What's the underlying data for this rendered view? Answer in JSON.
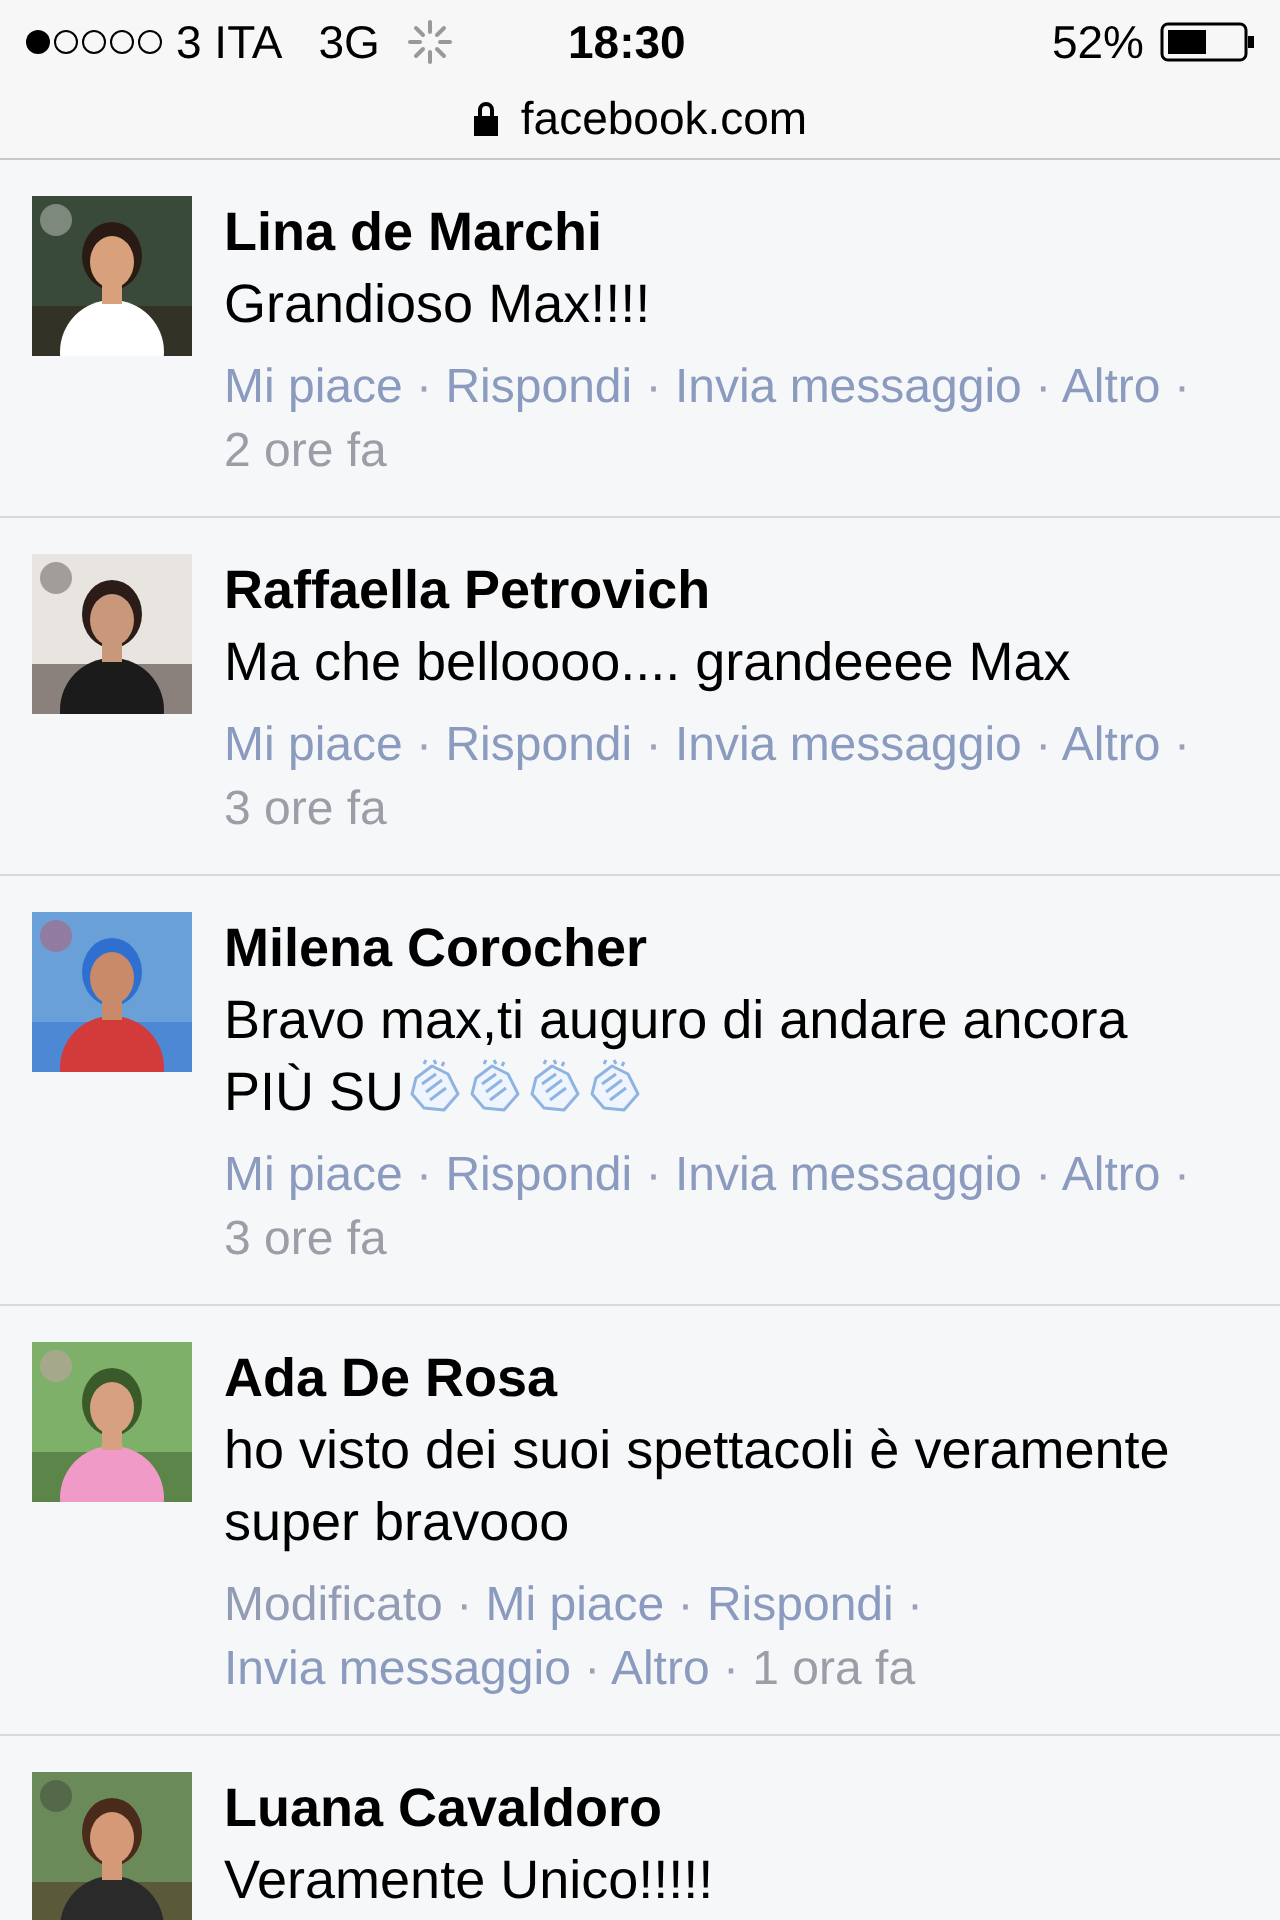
{
  "status_bar": {
    "carrier": "3 ITA",
    "network": "3G",
    "time": "18:30",
    "battery": "52%"
  },
  "address_bar": {
    "url": "facebook.com"
  },
  "separator": "·",
  "comments": [
    {
      "author": "Lina de Marchi",
      "text": "Grandioso Max!!!!",
      "actions": [
        {
          "kind": "link",
          "label": "Mi piace"
        },
        {
          "kind": "link",
          "label": "Rispondi"
        },
        {
          "kind": "link",
          "label": "Invia messaggio"
        },
        {
          "kind": "link",
          "label": "Altro"
        }
      ],
      "time": "2 ore fa"
    },
    {
      "author": "Raffaella Petrovich",
      "text": "Ma che belloooo.... grandeeee Max",
      "actions": [
        {
          "kind": "link",
          "label": "Mi piace"
        },
        {
          "kind": "link",
          "label": "Rispondi"
        },
        {
          "kind": "link",
          "label": "Invia messaggio"
        },
        {
          "kind": "link",
          "label": "Altro"
        }
      ],
      "time": "3 ore fa"
    },
    {
      "author": "Milena Corocher",
      "text": "Bravo max,ti auguro di andare ancora PIÙ SU",
      "trailing_icons": [
        {
          "kind": "clap"
        },
        {
          "kind": "clap"
        },
        {
          "kind": "clap"
        },
        {
          "kind": "clap"
        }
      ],
      "actions": [
        {
          "kind": "link",
          "label": "Mi piace"
        },
        {
          "kind": "link",
          "label": "Rispondi"
        },
        {
          "kind": "link",
          "label": "Invia messaggio"
        },
        {
          "kind": "link",
          "label": "Altro"
        }
      ],
      "time": "3 ore fa"
    },
    {
      "author": "Ada De Rosa",
      "text": "ho visto dei suoi spettacoli è veramente super bravooo",
      "actions": [
        {
          "kind": "label",
          "label": "Modificato"
        },
        {
          "kind": "link",
          "label": "Mi piace"
        },
        {
          "kind": "link",
          "label": "Rispondi"
        },
        {
          "kind": "link",
          "label": "Invia messaggio"
        },
        {
          "kind": "link",
          "label": "Altro"
        }
      ],
      "time": "1 ora fa"
    },
    {
      "author": "Luana Cavaldoro",
      "text": "Veramente Unico!!!!!"
    }
  ]
}
